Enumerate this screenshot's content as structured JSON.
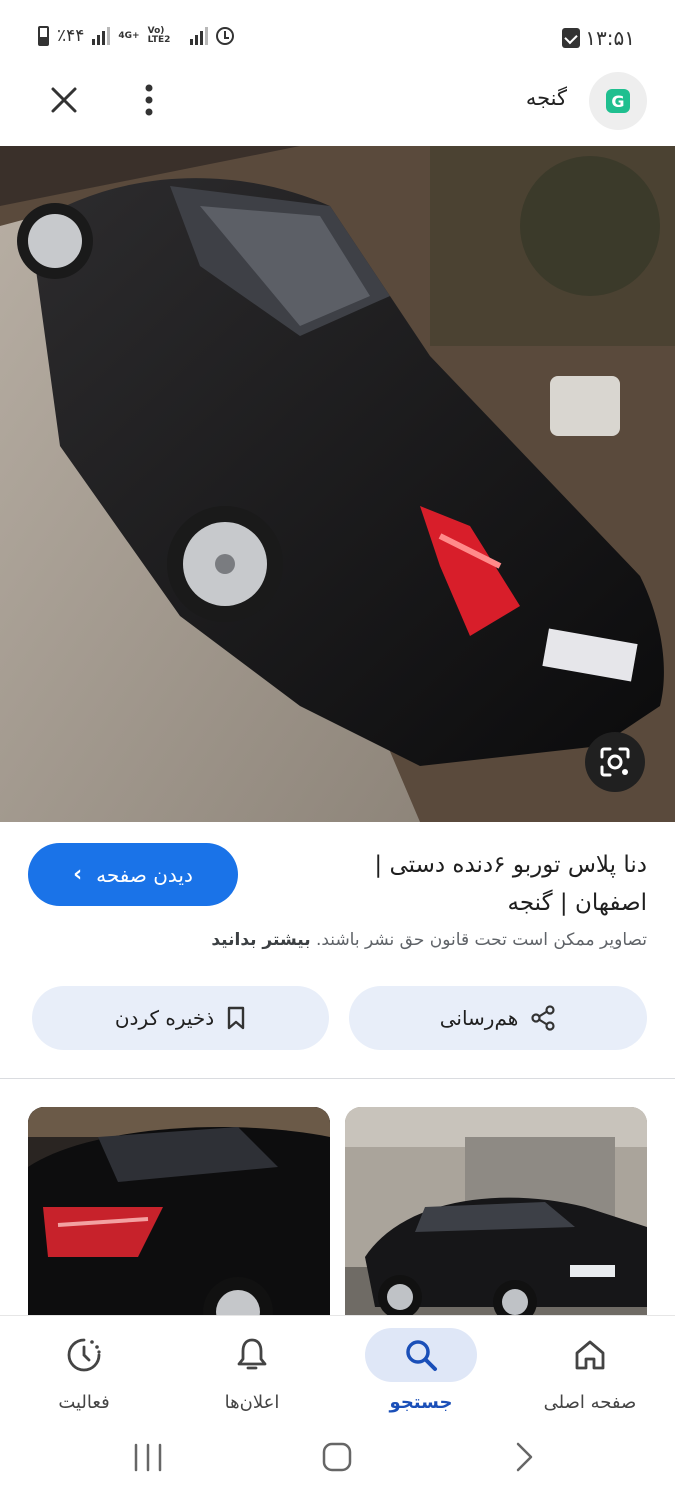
{
  "status_bar": {
    "time": "۱۳:۵۱",
    "battery": "٪۴۴",
    "network_1": "4G+",
    "network_2": "Vo) LTE2"
  },
  "header": {
    "site_name": "گنجه",
    "logo_letter": "G"
  },
  "result": {
    "title_line1": "دنا پلاس توربو ۶دنده دستی |",
    "title_line2": "اصفهان | گنجه",
    "visit_label": "دیدن صفحه",
    "copyright_text": "تصاویر ممکن است تحت قانون حق نشر باشند.",
    "learn_more": "بیشتر بدانید"
  },
  "actions": {
    "share_label": "هم‌رسانی",
    "save_label": "ذخیره کردن"
  },
  "bottom_nav": {
    "items": [
      {
        "label": "صفحه اصلی",
        "icon": "home-icon"
      },
      {
        "label": "جستجو",
        "icon": "search-icon"
      },
      {
        "label": "اعلان‌ها",
        "icon": "bell-icon"
      },
      {
        "label": "فعالیت",
        "icon": "activity-icon"
      }
    ],
    "active": "جستجو"
  },
  "colors": {
    "accent": "#1a73e8",
    "pill_bg": "#e8eef9",
    "active_nav_bg": "#dfe7f7",
    "logo_green": "#1fbf8f"
  }
}
